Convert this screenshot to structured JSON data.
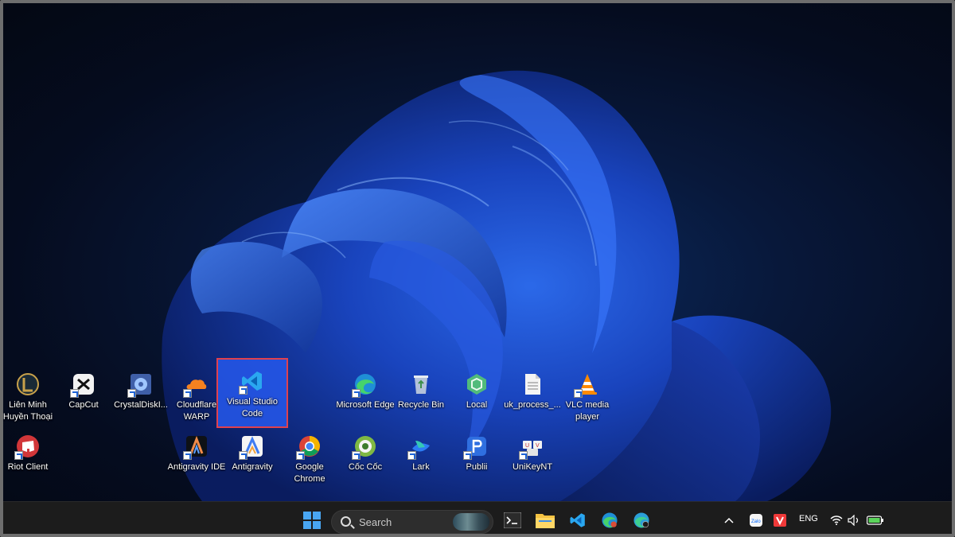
{
  "desktop": {
    "wallpaper": "Windows 11 bloom",
    "icons": [
      {
        "id": "lien-minh",
        "label": "Liên Minh Huyền Thoại",
        "icon": "league-of-legends-icon",
        "shortcut": false
      },
      {
        "id": "capcut",
        "label": "CapCut",
        "icon": "capcut-icon",
        "shortcut": true
      },
      {
        "id": "crystaldisk",
        "label": "CrystalDiskI...",
        "icon": "crystaldiskinfo-icon",
        "shortcut": true
      },
      {
        "id": "cloudflare",
        "label": "Cloudflare WARP",
        "icon": "cloudflare-warp-icon",
        "shortcut": true
      },
      {
        "id": "vscode",
        "label": "Visual Studio Code",
        "icon": "vscode-icon",
        "shortcut": true,
        "selected": true
      },
      {
        "id": "edge",
        "label": "Microsoft Edge",
        "icon": "edge-icon",
        "shortcut": true
      },
      {
        "id": "recycle",
        "label": "Recycle Bin",
        "icon": "recycle-bin-icon",
        "shortcut": false
      },
      {
        "id": "local",
        "label": "Local",
        "icon": "local-icon",
        "shortcut": false
      },
      {
        "id": "uk-process",
        "label": "uk_process_...",
        "icon": "document-icon",
        "shortcut": false
      },
      {
        "id": "vlc",
        "label": "VLC media player",
        "icon": "vlc-icon",
        "shortcut": true
      },
      {
        "id": "riot",
        "label": "Riot Client",
        "icon": "riot-client-icon",
        "shortcut": true
      },
      {
        "id": "antigravity-ide",
        "label": "Antigravity IDE",
        "icon": "antigravity-ide-icon",
        "shortcut": true
      },
      {
        "id": "antigravity",
        "label": "Antigravity",
        "icon": "antigravity-icon",
        "shortcut": true
      },
      {
        "id": "chrome",
        "label": "Google Chrome",
        "icon": "chrome-icon",
        "shortcut": true
      },
      {
        "id": "coccoc",
        "label": "Cốc Cốc",
        "icon": "coccoc-icon",
        "shortcut": true
      },
      {
        "id": "lark",
        "label": "Lark",
        "icon": "lark-icon",
        "shortcut": true
      },
      {
        "id": "publii",
        "label": "Publii",
        "icon": "publii-icon",
        "shortcut": true
      },
      {
        "id": "unikey",
        "label": "UniKeyNT",
        "icon": "unikey-icon",
        "shortcut": true
      }
    ]
  },
  "taskbar": {
    "search_placeholder": "Search",
    "pinned": [
      "start-icon",
      "terminal-icon",
      "file-explorer-icon",
      "vscode-icon",
      "edge-icon",
      "edge-dev-icon"
    ],
    "tray": {
      "language": "ENG",
      "icons": [
        "chevron-up-icon",
        "zalo-icon",
        "vivaldi-icon",
        "wifi-icon",
        "volume-icon",
        "battery-icon"
      ]
    }
  },
  "colors": {
    "selection": "#2658ec",
    "selection_border": "#e0414e",
    "taskbar": "#1c1c1c"
  }
}
